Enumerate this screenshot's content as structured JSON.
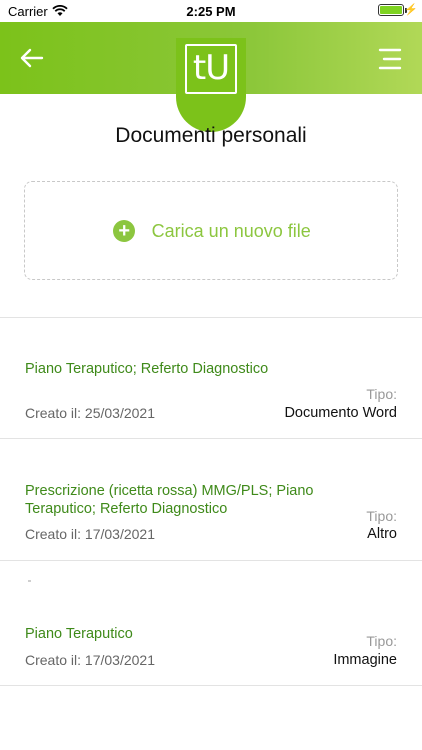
{
  "status_bar": {
    "carrier": "Carrier",
    "time": "2:25 PM",
    "battery_level": 1.0
  },
  "header": {
    "logo_text": "tU",
    "brand_color": "#7cc21a",
    "back_icon": "arrow-left-icon",
    "menu_icon": "hamburger-menu-icon"
  },
  "page": {
    "title": "Documenti personali"
  },
  "upload": {
    "icon": "plus-circle-icon",
    "label": "Carica un nuovo file"
  },
  "documents": [
    {
      "title": "Piano Teraputico; Referto Diagnostico",
      "date": "Creato il: 25/03/2021",
      "tipo_label": "Tipo:",
      "tipo_value": "Documento Word"
    },
    {
      "title": "Prescrizione (ricetta rossa) MMG/PLS; Piano Teraputico; Referto Diagnostico",
      "date": "Creato il: 17/03/2021",
      "tipo_label": "Tipo:",
      "tipo_value": "Altro"
    },
    {
      "title": "Piano Teraputico",
      "date": "Creato il: 17/03/2021",
      "tipo_label": "Tipo:",
      "tipo_value": "Immagine"
    }
  ]
}
